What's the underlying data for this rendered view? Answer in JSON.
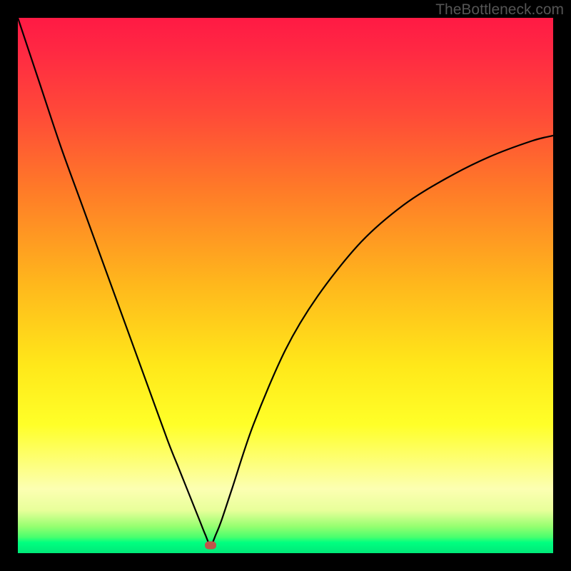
{
  "watermark": "TheBottleneck.com",
  "chart_data": {
    "type": "line",
    "title": "",
    "xlabel": "",
    "ylabel": "",
    "xlim": [
      0,
      100
    ],
    "ylim": [
      0,
      100
    ],
    "grid": false,
    "legend": false,
    "curve_min_x": 36,
    "marker": {
      "x": 36,
      "y": 1.5,
      "color": "#c0544a"
    },
    "series": [
      {
        "name": "bottleneck-curve",
        "color": "#000000",
        "x": [
          0,
          4,
          8,
          12,
          16,
          20,
          24,
          28,
          30,
          32,
          34,
          35,
          36,
          37,
          38,
          40,
          44,
          50,
          56,
          64,
          72,
          80,
          88,
          96,
          100
        ],
        "y": [
          100,
          88,
          76,
          65,
          54,
          43,
          32,
          21,
          16,
          11,
          6,
          3.5,
          1.5,
          3.5,
          6,
          12,
          24,
          38,
          48,
          58,
          65,
          70,
          74,
          77,
          78
        ]
      }
    ],
    "background_gradient": {
      "direction": "vertical",
      "stops": [
        {
          "pos": 0,
          "color": "#ff1a44"
        },
        {
          "pos": 32,
          "color": "#ff7a28"
        },
        {
          "pos": 65,
          "color": "#ffe81a"
        },
        {
          "pos": 95,
          "color": "#96ff70"
        },
        {
          "pos": 100,
          "color": "#00e878"
        }
      ]
    }
  }
}
